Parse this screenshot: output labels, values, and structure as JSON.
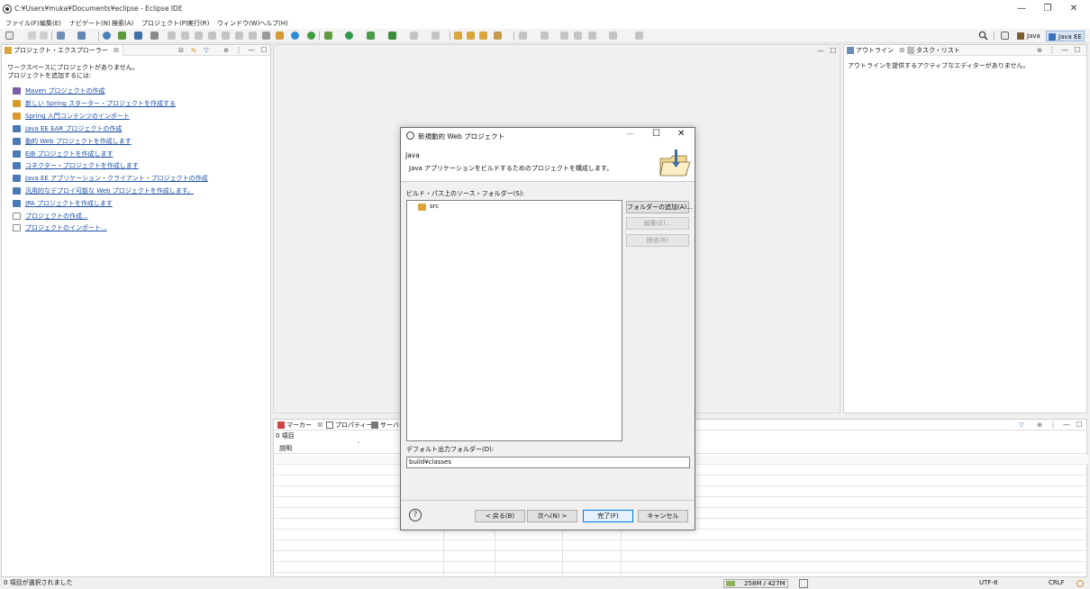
{
  "window": {
    "title": "C:¥Users¥muka¥Documents¥eclipse - Eclipse IDE",
    "controls": [
      "—",
      "❐",
      "✕"
    ]
  },
  "menu": [
    "ファイル(F)",
    "編集(E)",
    "ナビゲート(N)",
    "検索(A)",
    "プロジェクト(P)",
    "実行(R)",
    "ウィンドウ(W)",
    "ヘルプ(H)"
  ],
  "perspectives": [
    {
      "label": "Java",
      "icon": "java-perspective-icon",
      "color": "#7a5c2e"
    },
    {
      "label": "Java EE",
      "icon": "javaee-perspective-icon",
      "color": "#3b73b9"
    }
  ],
  "project_explorer": {
    "tab": "プロジェクト・エクスプローラー",
    "close": "☒",
    "message_1": "ワークスペースにプロジェクトがありません。",
    "message_2": "プロジェクトを追加するには:",
    "links": [
      {
        "label": "Maven プロジェクトの作成",
        "color": "#7b5ea7"
      },
      {
        "label": "新しい Spring スターター・プロジェクトを作成する",
        "color": "#d89a2b"
      },
      {
        "label": "Spring 入門コンテンツのインポート",
        "color": "#d89a2b"
      },
      {
        "label": "Java EE EAR プロジェクトの作成",
        "color": "#4a7ab5"
      },
      {
        "label": "動的 Web プロジェクトを作成します",
        "color": "#4a7ab5"
      },
      {
        "label": "EJB プロジェクトを作成します",
        "color": "#4a7ab5"
      },
      {
        "label": "コネクター・プロジェクトを作成します",
        "color": "#4a7ab5"
      },
      {
        "label": "Java EE アプリケーション・クライアント・プロジェクトの作成",
        "color": "#4a7ab5"
      },
      {
        "label": "汎用的なデプロイ可能な Web プロジェクトを作成します。",
        "color": "#4a7ab5"
      },
      {
        "label": "JPA プロジェクトを作成します",
        "color": "#4a7ab5"
      },
      {
        "label": "プロジェクトの作成...",
        "color": "#888888"
      },
      {
        "label": "プロジェクトのインポート...",
        "color": "#888888"
      }
    ]
  },
  "outline": {
    "tab": "アウトライン",
    "tab2": "タスク・リスト",
    "close": "☒",
    "message": "アウトラインを提供するアクティブなエディターがありません。"
  },
  "bottom": {
    "tabs": [
      "マーカー",
      "プロパティー",
      "サーバー"
    ],
    "close": "☒",
    "count": "0 項目",
    "column_header": "説明"
  },
  "status": {
    "left": "0 項目が選択されました",
    "memory": "258M / 427M",
    "encoding": "UTF-8",
    "line_ending": "CRLF"
  },
  "dialog": {
    "title": "新規動的 Web プロジェクト",
    "controls": [
      "—",
      "☐",
      "✕"
    ],
    "heading": "Java",
    "description": "Java アプリケーションをビルドするためのプロジェクトを構成します。",
    "source_label": "ビルド・パス上のソース・フォルダー(S):",
    "source_items": [
      "src"
    ],
    "add_folder": "フォルダーの追加(A)...",
    "edit": "編集(E)...",
    "remove": "除去(R)",
    "output_label": "デフォルト出力フォルダー(D):",
    "output_value": "build¥classes",
    "help": "?",
    "back": "< 戻る(B)",
    "next": "次へ(N) >",
    "finish": "完了(F)",
    "cancel": "キャンセル"
  }
}
